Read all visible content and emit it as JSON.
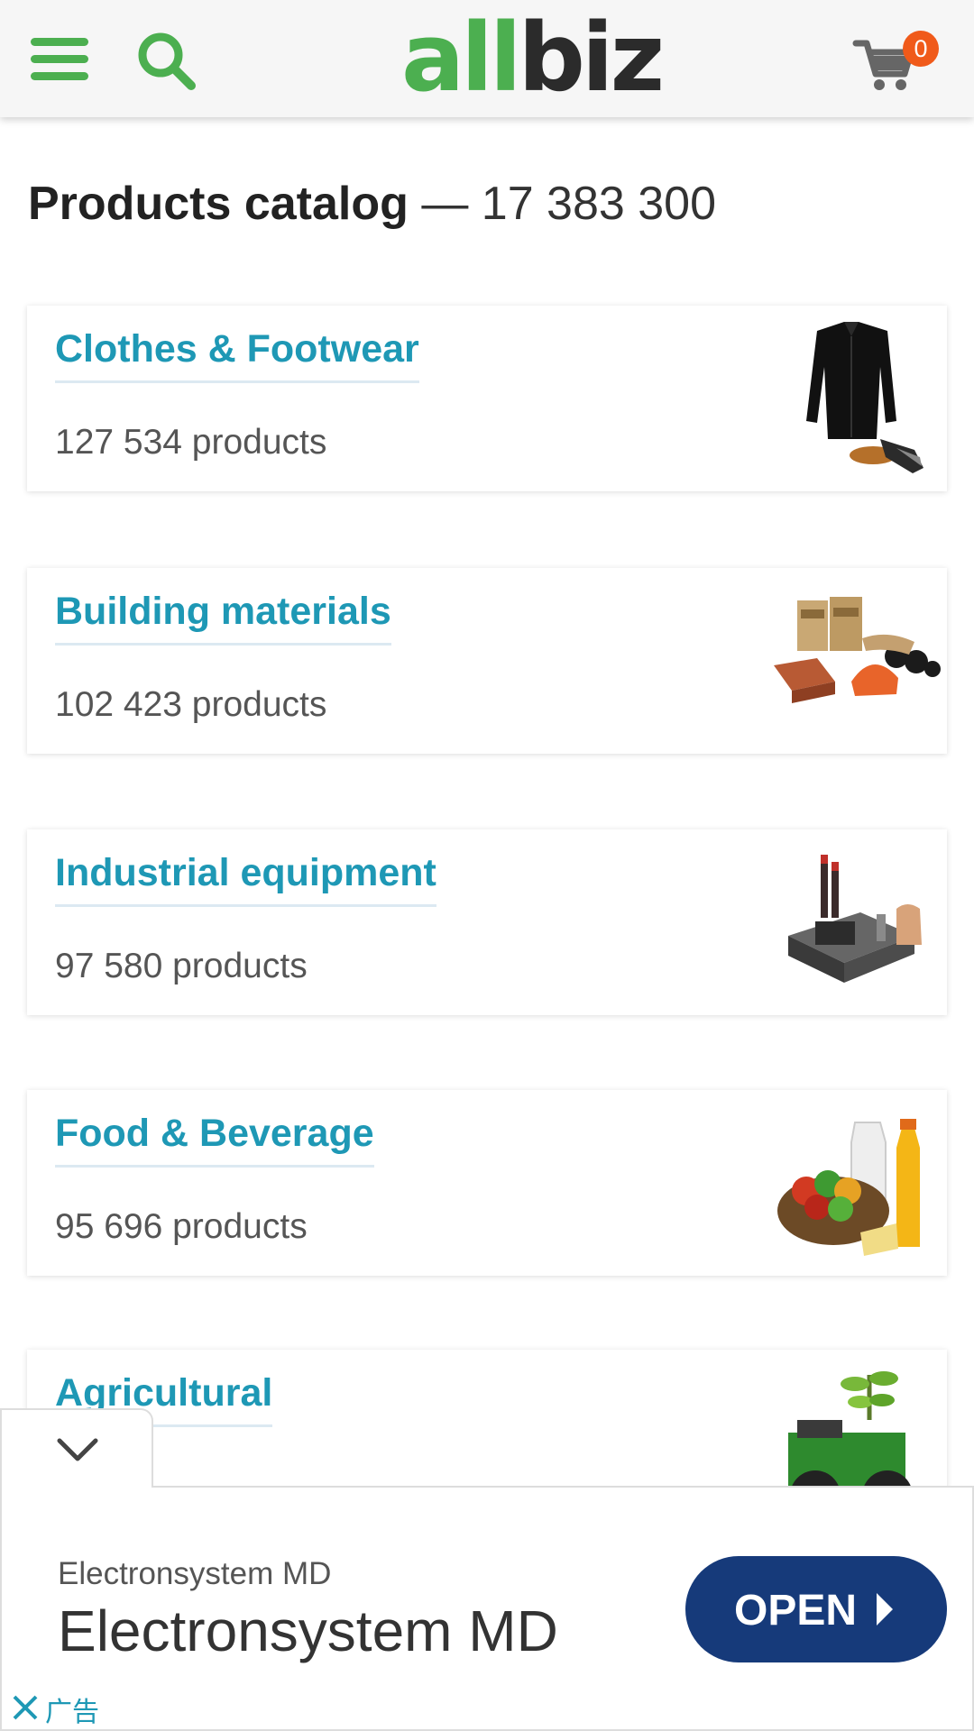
{
  "header": {
    "logo": {
      "part1": "all",
      "part2": "biz"
    },
    "cart_count": "0",
    "icons": {
      "menu": "hamburger-menu-icon",
      "search": "search-icon",
      "cart": "cart-icon"
    }
  },
  "title": {
    "strong": "Products catalog",
    "count": " — 17 383 300"
  },
  "categories": [
    {
      "name": "Clothes & Footwear",
      "count": "127 534 products",
      "image": "clothes-footwear-image"
    },
    {
      "name": "Building materials",
      "count": "102 423 products",
      "image": "building-materials-image"
    },
    {
      "name": "Industrial equipment",
      "count": "97 580 products",
      "image": "industrial-equipment-image"
    },
    {
      "name": "Food & Beverage",
      "count": "95 696 products",
      "image": "food-beverage-image"
    },
    {
      "name": "Agricultural",
      "count": "",
      "image": "agricultural-image"
    }
  ],
  "ad": {
    "subtitle": "Electronsystem MD",
    "title": "Electronsystem MD",
    "button": "OPEN",
    "label": "广告",
    "colors": {
      "button": "#163a7a",
      "label": "#1e98b5"
    }
  },
  "colors": {
    "brand_green": "#4caf50",
    "category_title": "#1e98b5",
    "badge": "#f05a1a"
  }
}
